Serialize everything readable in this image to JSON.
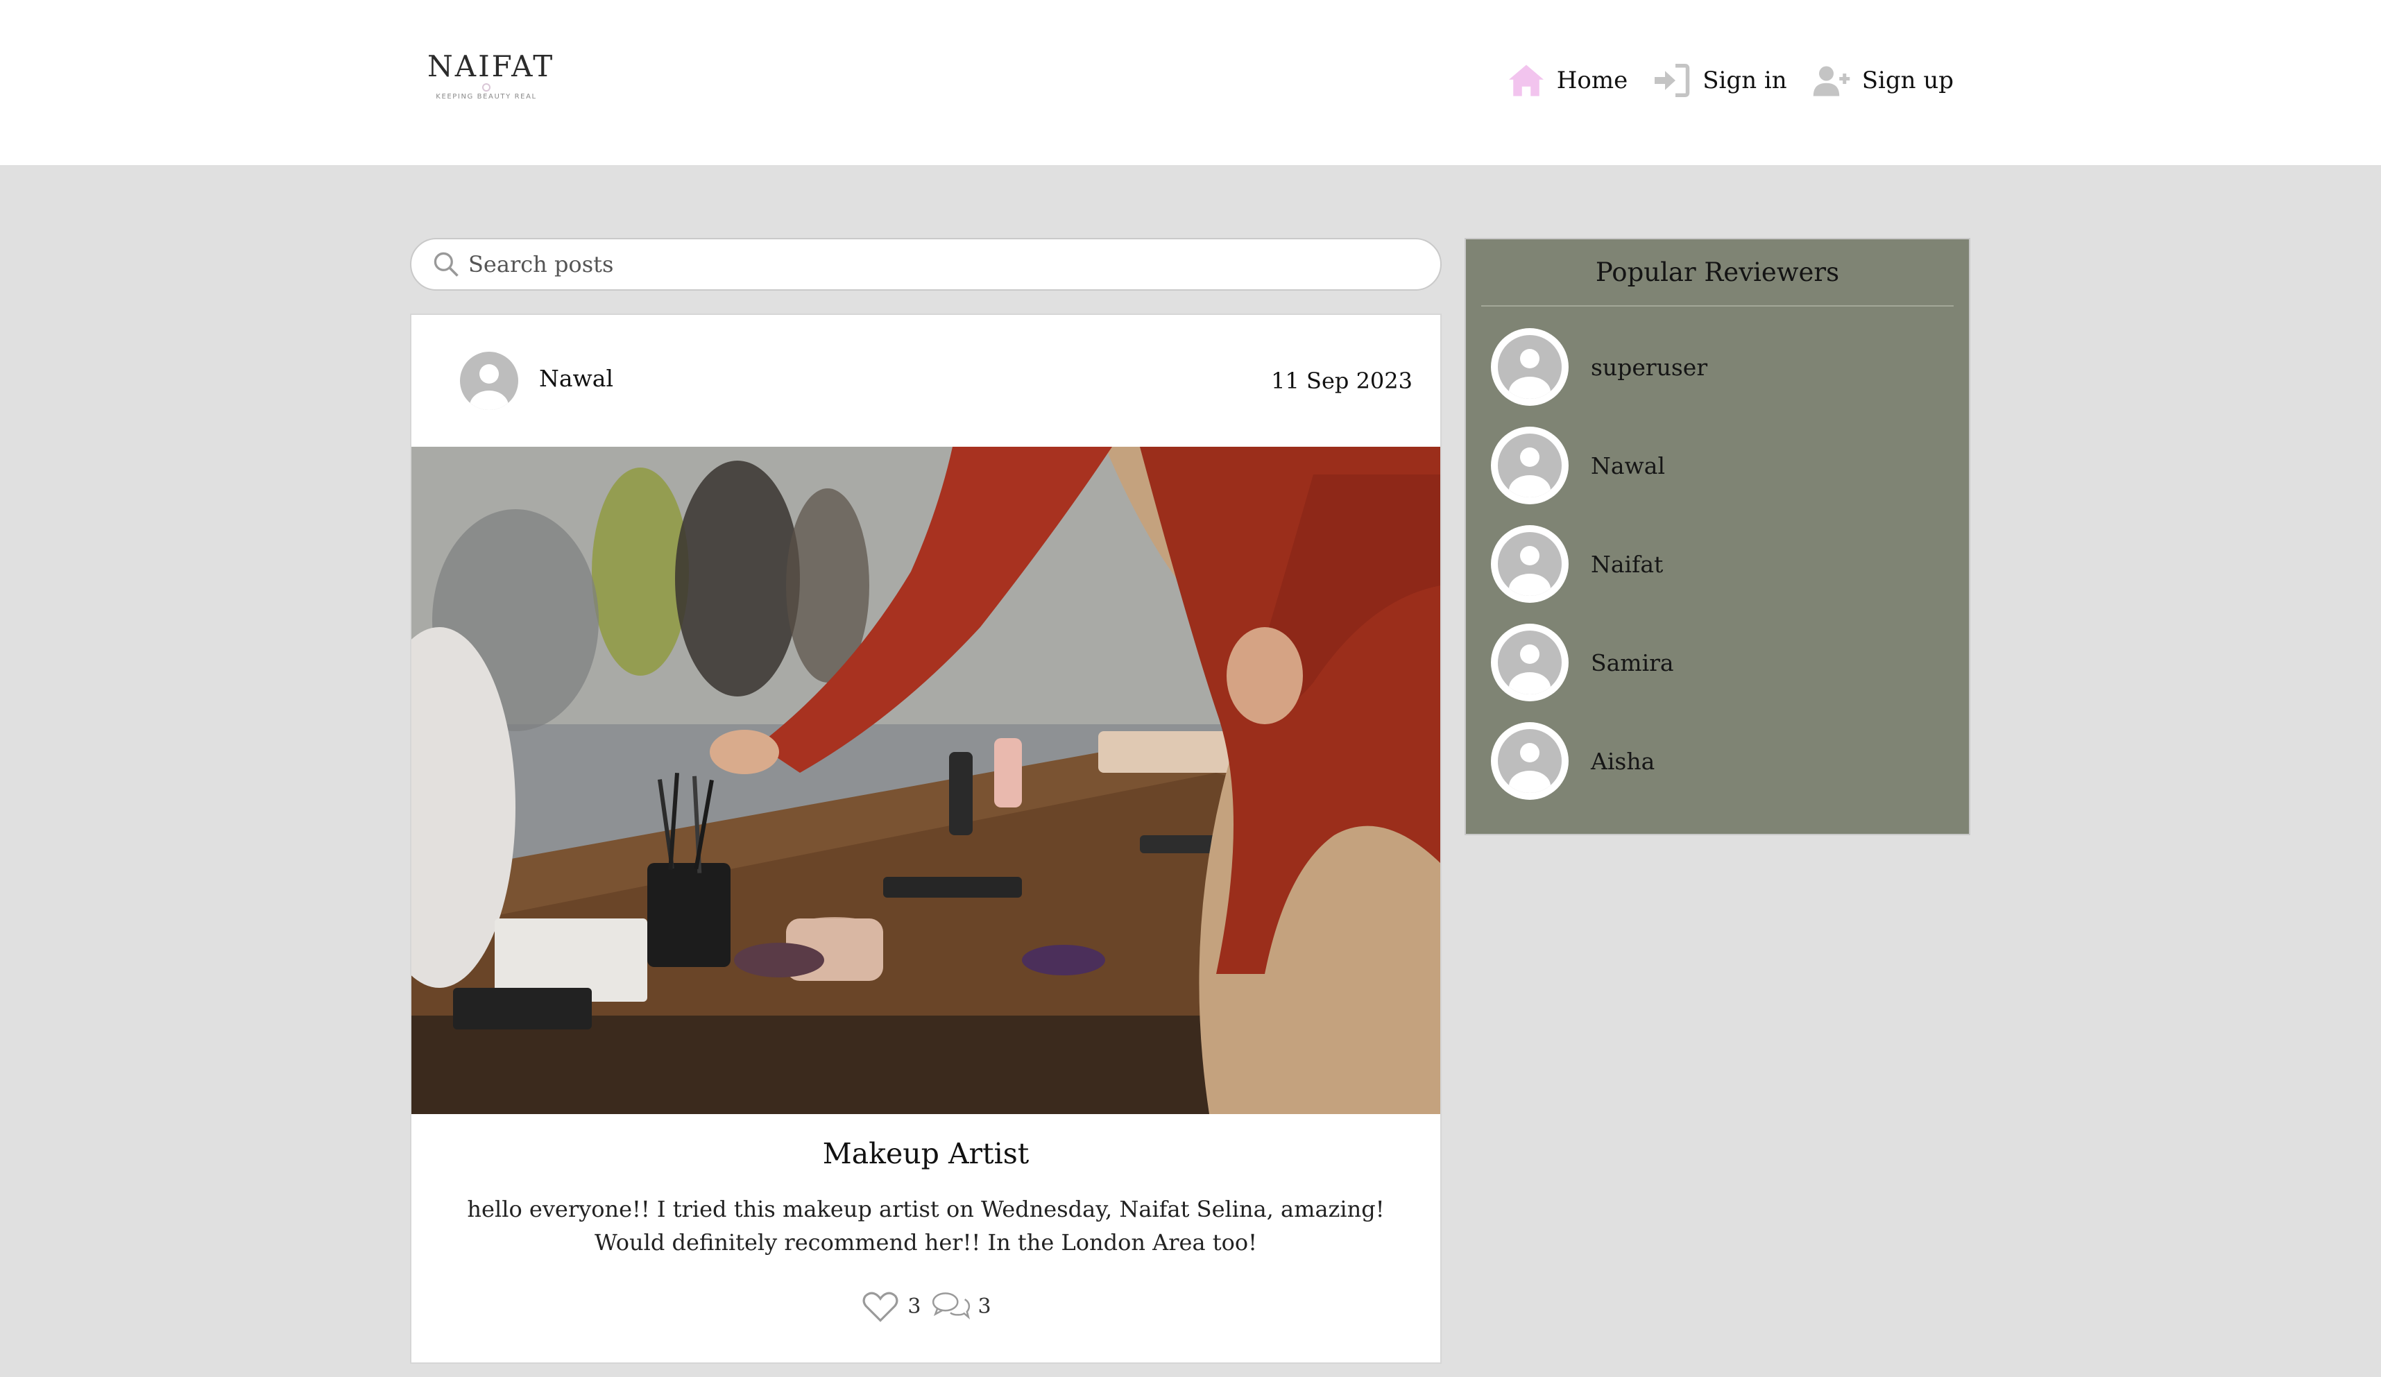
{
  "brand": {
    "name": "NAIFAT",
    "tagline": "KEEPING BEAUTY REAL"
  },
  "nav": {
    "items": [
      {
        "label": "Home",
        "icon": "home-icon",
        "color": "#f2c4ee"
      },
      {
        "label": "Sign in",
        "icon": "sign-in-icon",
        "color": "#c4c4c4"
      },
      {
        "label": "Sign up",
        "icon": "user-plus-icon",
        "color": "#c4c4c4"
      }
    ]
  },
  "search": {
    "placeholder": "Search posts"
  },
  "post": {
    "author": "Nawal",
    "date": "11 Sep 2023",
    "image_alt": "makeup-table-photo",
    "title": "Makeup Artist",
    "body": "hello everyone!! I tried this makeup artist on Wednesday, Naifat Selina, amazing! Would definitely recommend her!! In the London Area too!",
    "likes": "3",
    "comments": "3"
  },
  "sidebar": {
    "title": "Popular Reviewers",
    "reviewers": [
      {
        "name": "superuser"
      },
      {
        "name": "Nawal"
      },
      {
        "name": "Naifat"
      },
      {
        "name": "Samira"
      },
      {
        "name": "Aisha"
      }
    ]
  },
  "colors": {
    "page_background": "#e0e0e0",
    "sidebar_background": "#7f8474",
    "home_icon": "#f2c4ee",
    "muted_icon": "#c4c4c4"
  }
}
